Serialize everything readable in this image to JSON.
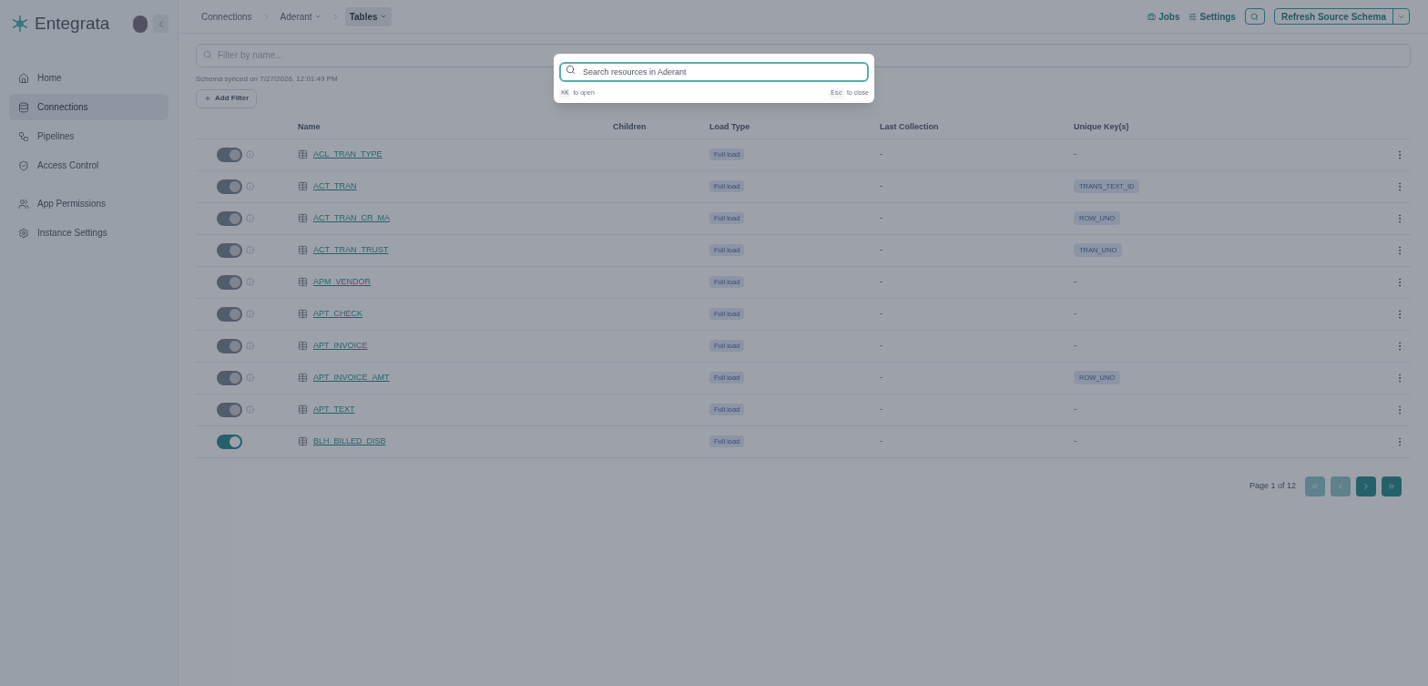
{
  "brand": {
    "name": "Entegrata"
  },
  "sidebar": {
    "items": [
      {
        "label": "Home",
        "selected": false
      },
      {
        "label": "Connections",
        "selected": true
      },
      {
        "label": "Pipelines",
        "selected": false
      },
      {
        "label": "Access Control",
        "selected": false
      },
      {
        "label": "App Permissions",
        "selected": false
      },
      {
        "label": "Instance Settings",
        "selected": false
      }
    ]
  },
  "breadcrumbs": [
    {
      "label": "Connections",
      "dropdown": false,
      "selected": false
    },
    {
      "label": "Aderant",
      "dropdown": true,
      "selected": false
    },
    {
      "label": "Tables",
      "dropdown": true,
      "selected": true
    }
  ],
  "header_actions": {
    "jobs": "Jobs",
    "settings": "Settings",
    "refresh": "Refresh Source Schema"
  },
  "filter": {
    "placeholder": "Filter by name..."
  },
  "sync_note": "Schema synced on 7/27/2026, 12:01:49 PM",
  "add_filter": "Add Filter",
  "table": {
    "columns": [
      "Name",
      "Children",
      "Load Type",
      "Last Collection",
      "Unique Key(s)"
    ],
    "rows": [
      {
        "on": true,
        "disabled": true,
        "name": "ACL_TRAN_TYPE",
        "load_type": "Full load",
        "last_collection": "-",
        "unique_key": "-",
        "kind": "text"
      },
      {
        "on": true,
        "disabled": true,
        "name": "ACT_TRAN",
        "load_type": "Full load",
        "last_collection": "-",
        "unique_key": "TRANS_TEXT_ID",
        "kind": "tag"
      },
      {
        "on": true,
        "disabled": true,
        "name": "ACT_TRAN_CR_MA",
        "load_type": "Full load",
        "last_collection": "-",
        "unique_key": "ROW_UNO",
        "kind": "tag"
      },
      {
        "on": true,
        "disabled": true,
        "name": "ACT_TRAN_TRUST",
        "load_type": "Full load",
        "last_collection": "-",
        "unique_key": "TRAN_UNO",
        "kind": "tag"
      },
      {
        "on": true,
        "disabled": true,
        "name": "APM_VENDOR",
        "load_type": "Full load",
        "last_collection": "-",
        "unique_key": "-",
        "kind": "text"
      },
      {
        "on": true,
        "disabled": true,
        "name": "APT_CHECK",
        "load_type": "Full load",
        "last_collection": "-",
        "unique_key": "-",
        "kind": "text"
      },
      {
        "on": true,
        "disabled": true,
        "name": "APT_INVOICE",
        "load_type": "Full load",
        "last_collection": "-",
        "unique_key": "-",
        "kind": "text"
      },
      {
        "on": true,
        "disabled": true,
        "name": "APT_INVOICE_AMT",
        "load_type": "Full load",
        "last_collection": "-",
        "unique_key": "ROW_UNO",
        "kind": "tag"
      },
      {
        "on": true,
        "disabled": true,
        "name": "APT_TEXT",
        "load_type": "Full load",
        "last_collection": "-",
        "unique_key": "-",
        "kind": "text"
      },
      {
        "on": true,
        "disabled": false,
        "name": "BLH_BILLED_DISB",
        "load_type": "Full load",
        "last_collection": "-",
        "unique_key": "-",
        "kind": "text"
      }
    ]
  },
  "pagination": {
    "label": "Page 1 of 12",
    "buttons": [
      {
        "kind": "first",
        "disabled": true
      },
      {
        "kind": "prev",
        "disabled": true
      },
      {
        "kind": "next",
        "disabled": false
      },
      {
        "kind": "last",
        "disabled": false
      }
    ]
  },
  "search_dialog": {
    "placeholder": "Search resources in Aderant",
    "open_key": "⌘K",
    "open_hint": "to open",
    "close_key": "Esc",
    "close_hint": "to close"
  }
}
